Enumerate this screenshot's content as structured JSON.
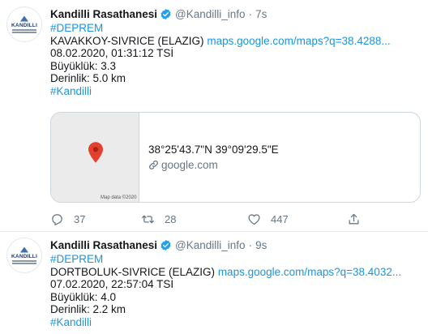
{
  "colors": {
    "link": "#1b95e0",
    "verified": "#1da1f2",
    "secondary": "#657786",
    "pin": "#e4402f"
  },
  "tweets": [
    {
      "author": {
        "avatar_text": "KANDILLI",
        "name": "Kandilli Rasathanesi",
        "handle": "@Kandilli_info",
        "verified": true
      },
      "time": "7s",
      "hashtag_top": "#DEPREM",
      "location": "KAVAKKOY-SIVRICE (ELAZIG)",
      "map_link": "maps.google.com/maps?q=38.4288...",
      "datetime": "08.02.2020, 01:31:12 TSİ",
      "magnitude": "Büyüklük: 3.3",
      "depth": "Derinlik: 5.0 km",
      "hashtag_bottom": "#Kandilli",
      "card": {
        "map_credit": "Map data ©2020",
        "coords": "38°25'43.7\"N 39°09'29.5\"E",
        "domain": "google.com"
      },
      "stats": {
        "replies": "37",
        "retweets": "28",
        "likes": "447"
      }
    },
    {
      "author": {
        "avatar_text": "KANDILLI",
        "name": "Kandilli Rasathanesi",
        "handle": "@Kandilli_info",
        "verified": true
      },
      "time": "9s",
      "hashtag_top": "#DEPREM",
      "location": "DORTBOLUK-SIVRICE (ELAZIG)",
      "map_link": "maps.google.com/maps?q=38.4032...",
      "datetime": "07.02.2020, 22:57:04 TSİ",
      "magnitude": "Büyüklük: 4.0",
      "depth": "Derinlik: 2.2 km",
      "hashtag_bottom": "#Kandilli"
    }
  ]
}
